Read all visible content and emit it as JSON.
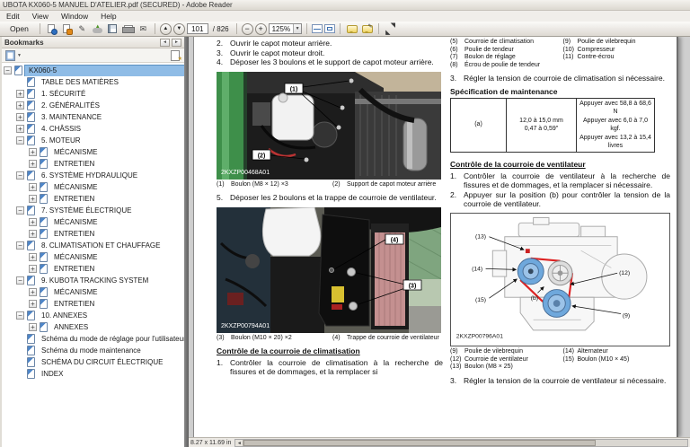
{
  "window": {
    "title": "UBOTA KX060-5 MANUEL D'ATELIER.pdf (SECURED) - Adobe Reader",
    "menu_items": [
      "Edit",
      "View",
      "Window",
      "Help"
    ]
  },
  "toolbar": {
    "open_label": "Open",
    "page_current": "101",
    "page_total": "/ 826",
    "zoom_value": "125%"
  },
  "icons": {
    "previous_page_glyph": "▲",
    "next_page_glyph": "▼",
    "zoom_out_glyph": "−",
    "zoom_in_glyph": "+",
    "dropdown_glyph": "▼",
    "email_glyph": "✉",
    "sign_glyph": "✎",
    "scroll_left_glyph": "◄",
    "panel_collapse_glyph": "◄",
    "panel_expand_glyph": "►",
    "toggle_plus_glyph": "+",
    "toggle_minus_glyph": "−"
  },
  "bookmarks_panel": {
    "title": "Bookmarks",
    "items": [
      {
        "label": "KX060-5",
        "indent": 0,
        "toggle": "minus",
        "selected": true
      },
      {
        "label": "TABLE DES MATIÈRES",
        "indent": 1,
        "toggle": "none",
        "selected": false
      },
      {
        "label": "1. SÉCURITÉ",
        "indent": 1,
        "toggle": "plus",
        "selected": false
      },
      {
        "label": "2. GÉNÉRALITÉS",
        "indent": 1,
        "toggle": "plus",
        "selected": false
      },
      {
        "label": "3. MAINTENANCE",
        "indent": 1,
        "toggle": "plus",
        "selected": false
      },
      {
        "label": "4. CHÂSSIS",
        "indent": 1,
        "toggle": "plus",
        "selected": false
      },
      {
        "label": "5. MOTEUR",
        "indent": 1,
        "toggle": "minus",
        "selected": false
      },
      {
        "label": "MÉCANISME",
        "indent": 2,
        "toggle": "plus",
        "selected": false
      },
      {
        "label": "ENTRETIEN",
        "indent": 2,
        "toggle": "plus",
        "selected": false
      },
      {
        "label": "6. SYSTÈME HYDRAULIQUE",
        "indent": 1,
        "toggle": "minus",
        "selected": false
      },
      {
        "label": "MÉCANISME",
        "indent": 2,
        "toggle": "plus",
        "selected": false
      },
      {
        "label": "ENTRETIEN",
        "indent": 2,
        "toggle": "plus",
        "selected": false
      },
      {
        "label": "7. SYSTÈME ÉLECTRIQUE",
        "indent": 1,
        "toggle": "minus",
        "selected": false
      },
      {
        "label": "MÉCANISME",
        "indent": 2,
        "toggle": "plus",
        "selected": false
      },
      {
        "label": "ENTRETIEN",
        "indent": 2,
        "toggle": "plus",
        "selected": false
      },
      {
        "label": "8. CLIMATISATION ET CHAUFFAGE",
        "indent": 1,
        "toggle": "minus",
        "selected": false
      },
      {
        "label": "MÉCANISME",
        "indent": 2,
        "toggle": "plus",
        "selected": false
      },
      {
        "label": "ENTRETIEN",
        "indent": 2,
        "toggle": "plus",
        "selected": false
      },
      {
        "label": "9. KUBOTA TRACKING SYSTEM",
        "indent": 1,
        "toggle": "minus",
        "selected": false
      },
      {
        "label": "MÉCANISME",
        "indent": 2,
        "toggle": "plus",
        "selected": false
      },
      {
        "label": "ENTRETIEN",
        "indent": 2,
        "toggle": "plus",
        "selected": false
      },
      {
        "label": "10. ANNEXES",
        "indent": 1,
        "toggle": "minus",
        "selected": false
      },
      {
        "label": "ANNEXES",
        "indent": 2,
        "toggle": "plus",
        "selected": false
      },
      {
        "label": "Schéma du mode de réglage pour l'utilisateur",
        "indent": 1,
        "toggle": "none",
        "selected": false
      },
      {
        "label": "Schéma du mode maintenance",
        "indent": 1,
        "toggle": "none",
        "selected": false
      },
      {
        "label": "SCHÉMA DU CIRCUIT ÉLECTRIQUE",
        "indent": 1,
        "toggle": "none",
        "selected": false
      },
      {
        "label": "INDEX",
        "indent": 1,
        "toggle": "none",
        "selected": false
      }
    ]
  },
  "document": {
    "left_column": {
      "steps": [
        {
          "num": "2.",
          "text": "Ouvrir le capot moteur arrière."
        },
        {
          "num": "3.",
          "text": "Ouvrir le capot moteur droit."
        },
        {
          "num": "4.",
          "text": "Déposer les 3 boulons et le support de capot moteur arrière."
        }
      ],
      "photo1_code": "2KXZP00468A01",
      "photo1_labels": {
        "l1": "(1)",
        "l2": "(2)"
      },
      "photo1_caption": [
        [
          "(1)",
          "Boulon (M8 × 12) ×3"
        ],
        [
          "(2)",
          "Support de capot moteur arrière"
        ]
      ],
      "step5": {
        "num": "5.",
        "text": "Déposer les 2 boulons et la trappe de courroie de ventilateur."
      },
      "photo2_code": "2KXZP00794A01",
      "photo2_labels": {
        "l3": "(3)",
        "l4": "(4)"
      },
      "photo2_caption": [
        [
          "(3)",
          "Boulon (M10 × 20) ×2"
        ],
        [
          "(4)",
          "Trappe de courroie de ventilateur"
        ]
      ],
      "clim_heading": "Contrôle de la courroie de climatisation",
      "clim_step1": {
        "num": "1.",
        "text": "Contrôler la courroie de climatisation à la recherche de fissures et de dommages, et la remplacer si"
      }
    },
    "right_column": {
      "parts_caption_col1": [
        [
          "(5)",
          "Courroie de climatisation"
        ],
        [
          "(6)",
          "Poulie de tendeur"
        ],
        [
          "(7)",
          "Boulon de réglage"
        ],
        [
          "(8)",
          "Écrou de poulie de tendeur"
        ]
      ],
      "parts_caption_col2": [
        [
          "(9)",
          "Poulie de vilebrequin"
        ],
        [
          "(10)",
          "Compresseur"
        ],
        [
          "(11)",
          "Contre-écrou"
        ]
      ],
      "clim_step3": {
        "num": "3.",
        "text": "Régler la tension de courroie de climatisation si nécessaire."
      },
      "spec_heading": "Spécification de maintenance",
      "spec_table": {
        "ref": "(a)",
        "value_lines": [
          "12,0 à 15,0 mm",
          "0,47 à 0,59\""
        ],
        "criteria_lines": [
          "Appuyer avec 58,8 à 68,6 N",
          "Appuyer avec 6,0 à 7,0 kgf.",
          "Appuyer avec 13,2 à 15,4 livres"
        ]
      },
      "fan_heading": "Contrôle de la courroie de ventilateur",
      "fan_step1": {
        "num": "1.",
        "text": "Contrôler la courroie de ventilateur à la recherche de fissures et de dommages, et la remplacer si nécessaire."
      },
      "fan_step2": {
        "num": "2.",
        "text": "Appuyer sur la position (b) pour contrôler la tension de la courroie de ventilateur."
      },
      "diagram_code": "2KXZP00796A01",
      "diagram_labels": {
        "l13": "(13)",
        "l14": "(14)",
        "l15": "(15)",
        "lb": "(b)",
        "l12": "(12)",
        "l9": "(9)"
      },
      "diagram_caption_col1": [
        [
          "(9)",
          "Poulie de vilebrequin"
        ],
        [
          "(12)",
          "Courroie de ventilateur"
        ],
        [
          "(13)",
          "Boulon (M8 × 25)"
        ]
      ],
      "diagram_caption_col2": [
        [
          "(14)",
          "Alternateur"
        ],
        [
          "(15)",
          "Boulon (M10 × 45)"
        ]
      ],
      "fan_step3": {
        "num": "3.",
        "text": "Régler la tension de la courroie de ventilateur si nécessaire."
      }
    }
  },
  "statusbar": {
    "page_size": "8.27 x 11.69 in"
  }
}
